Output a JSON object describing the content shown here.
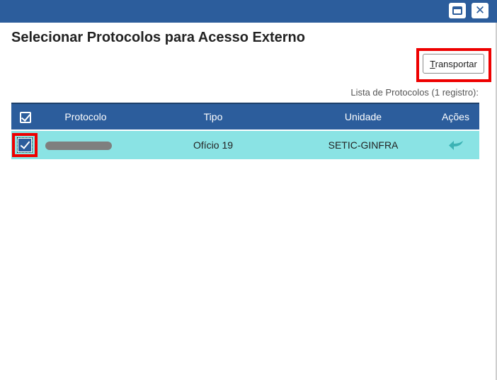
{
  "window": {
    "maximize_icon": "maximize-icon",
    "close_icon": "close-icon",
    "close_glyph": "✕"
  },
  "page": {
    "title": "Selecionar Protocolos para Acesso Externo"
  },
  "toolbar": {
    "transport_access_key": "T",
    "transport_label_rest": "ransportar"
  },
  "list": {
    "caption": "Lista de Protocolos (1 registro):",
    "columns": {
      "protocolo": "Protocolo",
      "tipo": "Tipo",
      "unidade": "Unidade",
      "acoes": "Ações"
    },
    "rows": [
      {
        "selected": true,
        "protocolo_redacted": true,
        "tipo": "Ofício 19",
        "unidade": "SETIC-GINFRA",
        "action_icon": "transport-arrow-icon"
      }
    ]
  },
  "colors": {
    "header_bg": "#2c5d9c",
    "row_selected_bg": "#8ae3e4",
    "highlight": "#ee0000",
    "action_icon": "#3cb3b5"
  }
}
